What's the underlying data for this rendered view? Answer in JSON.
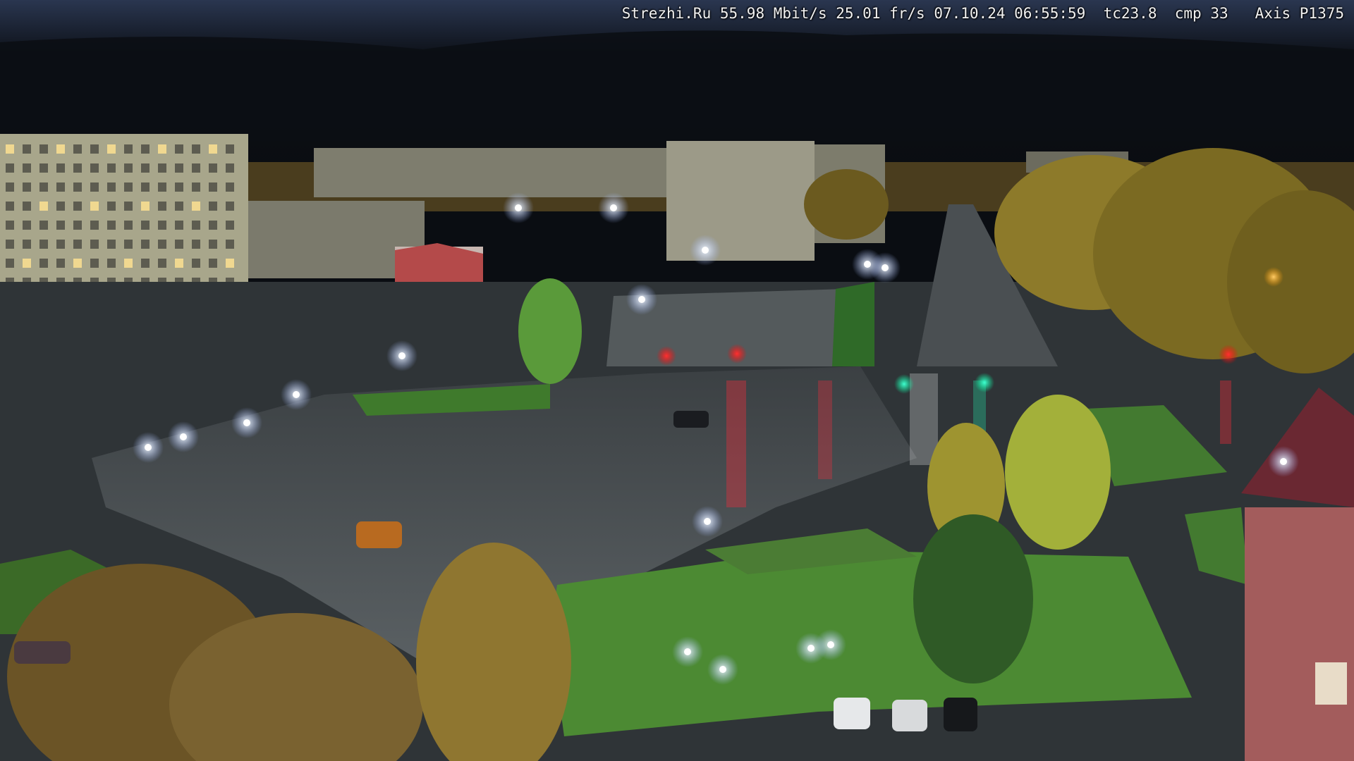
{
  "camera_overlay": {
    "site": "Strezhi.Ru",
    "bitrate": "55.98 Mbit/s",
    "framerate": "25.01 fr/s",
    "date": "07.10.24",
    "time": "06:55:59",
    "tc": "tc23.8",
    "cmp": "cmp 33",
    "model": "Axis P1375"
  },
  "colors": {
    "sky_top": "#1f2a3c",
    "sky_clouds": "#0c0f16",
    "building": "#a7a48a",
    "road": "#3e4448",
    "grass": "#3f7a2c",
    "tree_autumn": "#b39433",
    "lamp": "#eaf3ff",
    "traffic_red": "#ff2a2a",
    "traffic_green": "#24f0b0",
    "store_neon": "#5c6cff"
  }
}
